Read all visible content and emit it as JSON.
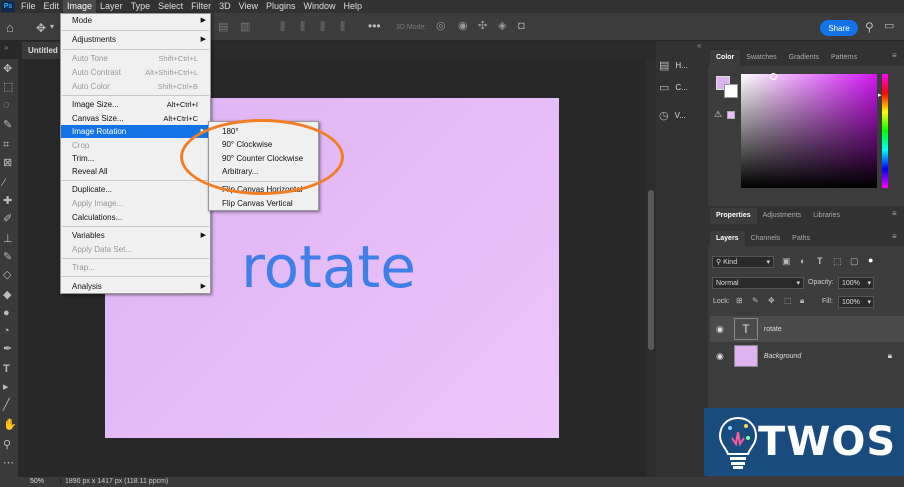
{
  "menubar": {
    "app_icon": "Ps",
    "items": [
      "File",
      "Edit",
      "Image",
      "Layer",
      "Type",
      "Select",
      "Filter",
      "3D",
      "View",
      "Plugins",
      "Window",
      "Help"
    ]
  },
  "optionsbar": {
    "mode_3d": "3D Mode:",
    "share_label": "Share"
  },
  "document": {
    "tab_title": "Untitled",
    "canvas_text": "rotate",
    "zoom": "50%",
    "info": "1890 px x 1417 px (118.11 ppcm)"
  },
  "image_menu": {
    "mode": "Mode",
    "adjustments": "Adjustments",
    "auto_tone": "Auto Tone",
    "auto_tone_sc": "Shift+Ctrl+L",
    "auto_contrast": "Auto Contrast",
    "auto_contrast_sc": "Alt+Shift+Ctrl+L",
    "auto_color": "Auto Color",
    "auto_color_sc": "Shift+Ctrl+B",
    "image_size": "Image Size...",
    "image_size_sc": "Alt+Ctrl+I",
    "canvas_size": "Canvas Size...",
    "canvas_size_sc": "Alt+Ctrl+C",
    "image_rotation": "Image Rotation",
    "crop": "Crop",
    "trim": "Trim...",
    "reveal_all": "Reveal All",
    "duplicate": "Duplicate...",
    "apply_image": "Apply Image...",
    "calculations": "Calculations...",
    "variables": "Variables",
    "apply_data_set": "Apply Data Set...",
    "trap": "Trap...",
    "analysis": "Analysis"
  },
  "rotation_submenu": {
    "r180": "180°",
    "cw": "90° Clockwise",
    "ccw": "90° Counter Clockwise",
    "arbitrary": "Arbitrary...",
    "flip_h": "Flip Canvas Horizontal",
    "flip_v": "Flip Canvas Vertical"
  },
  "collapsed_panels": [
    "H...",
    "C...",
    "V..."
  ],
  "color_panel": {
    "tabs": [
      "Color",
      "Swatches",
      "Gradients",
      "Patterns"
    ],
    "foreground": "#deb3f2",
    "background": "#ffffff"
  },
  "properties_tabs": [
    "Properties",
    "Adjustments",
    "Libraries"
  ],
  "layers_panel": {
    "tabs": [
      "Layers",
      "Channels",
      "Paths"
    ],
    "filter_kind": "Kind",
    "blend_mode": "Normal",
    "opacity_label": "Opacity:",
    "opacity_value": "100%",
    "lock_label": "Lock:",
    "fill_label": "Fill:",
    "fill_value": "100%",
    "layers": [
      {
        "name": "rotate",
        "thumb": "T"
      },
      {
        "name": "Background"
      }
    ]
  },
  "watermark": {
    "text": "TWOS"
  },
  "colors": {
    "accent": "#1473e6",
    "highlight_ring": "#f27e24",
    "canvas": "#deb3f2",
    "canvas_text": "#3f7fe8"
  }
}
